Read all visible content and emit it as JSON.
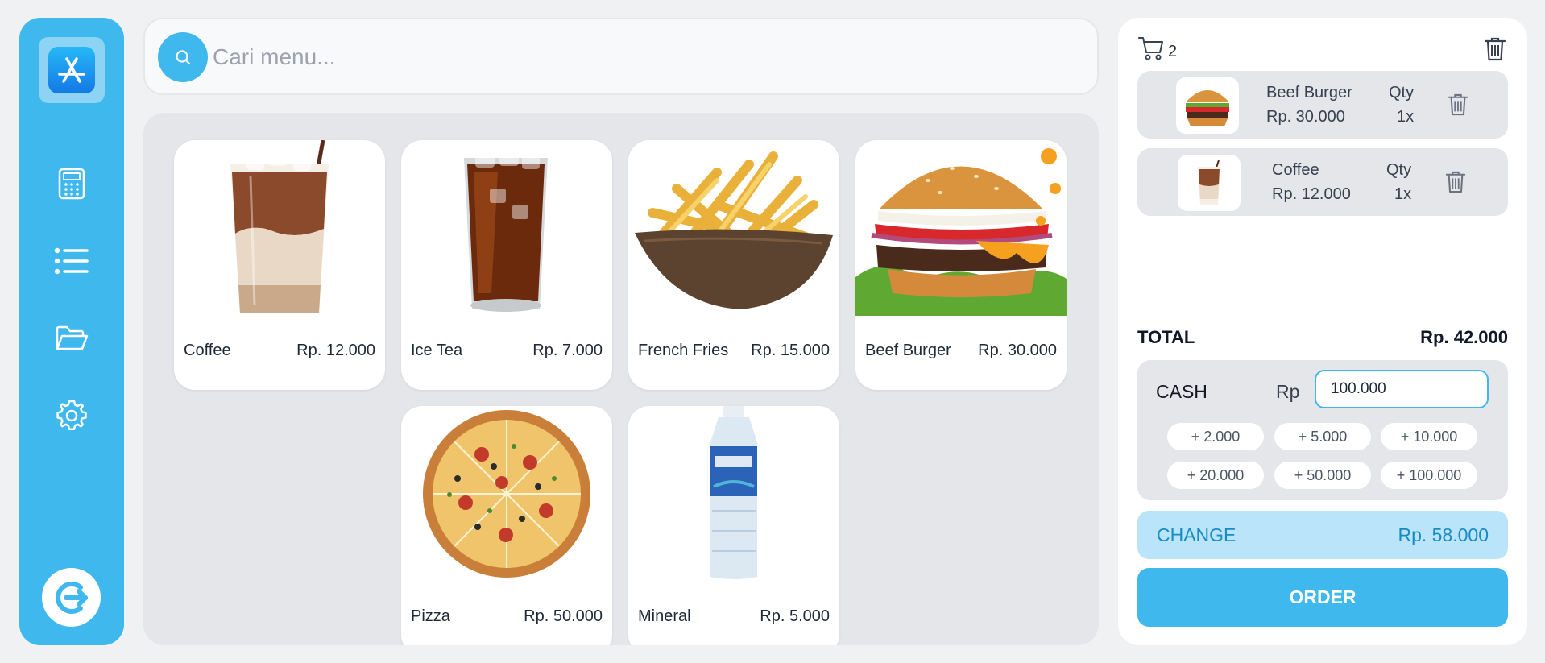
{
  "sidebar": {
    "logo_icon": "app-store-icon",
    "items": [
      {
        "icon": "calculator-icon"
      },
      {
        "icon": "list-icon"
      },
      {
        "icon": "folder-icon"
      },
      {
        "icon": "gear-icon"
      }
    ],
    "logout_icon": "logout-icon"
  },
  "search": {
    "placeholder": "Cari menu...",
    "icon": "search-icon"
  },
  "menu": {
    "items": [
      {
        "name": "Coffee",
        "price": "Rp. 12.000",
        "image": "iced-coffee-glass"
      },
      {
        "name": "Ice Tea",
        "price": "Rp. 7.000",
        "image": "iced-tea-glass"
      },
      {
        "name": "French Fries",
        "price": "Rp. 15.000",
        "image": "fries-basket"
      },
      {
        "name": "Beef Burger",
        "price": "Rp. 30.000",
        "image": "burger"
      },
      {
        "name": "Pizza",
        "price": "Rp. 50.000",
        "image": "pizza"
      },
      {
        "name": "Mineral",
        "price": "Rp. 5.000",
        "image": "water-bottle"
      }
    ]
  },
  "cart": {
    "count": "2",
    "icon": "cart-icon",
    "clear_icon": "trash-icon",
    "items": [
      {
        "name": "Beef Burger",
        "price": "Rp. 30.000",
        "qty_label": "Qty",
        "qty": "1x"
      },
      {
        "name": "Coffee",
        "price": "Rp. 12.000",
        "qty_label": "Qty",
        "qty": "1x"
      }
    ],
    "total_label": "TOTAL",
    "total_value": "Rp. 42.000",
    "cash_label": "CASH",
    "currency_label": "Rp",
    "cash_value": "100.000",
    "quick_amounts": [
      "+ 2.000",
      "+ 5.000",
      "+ 10.000",
      "+ 20.000",
      "+ 50.000",
      "+ 100.000"
    ],
    "change_label": "CHANGE",
    "change_value": "Rp. 58.000",
    "order_label": "ORDER"
  },
  "colors": {
    "accent": "#3fb8ee",
    "change_bg": "#b9e4f9",
    "change_text": "#1a8cc4",
    "panel_bg": "#e5e6e9"
  }
}
